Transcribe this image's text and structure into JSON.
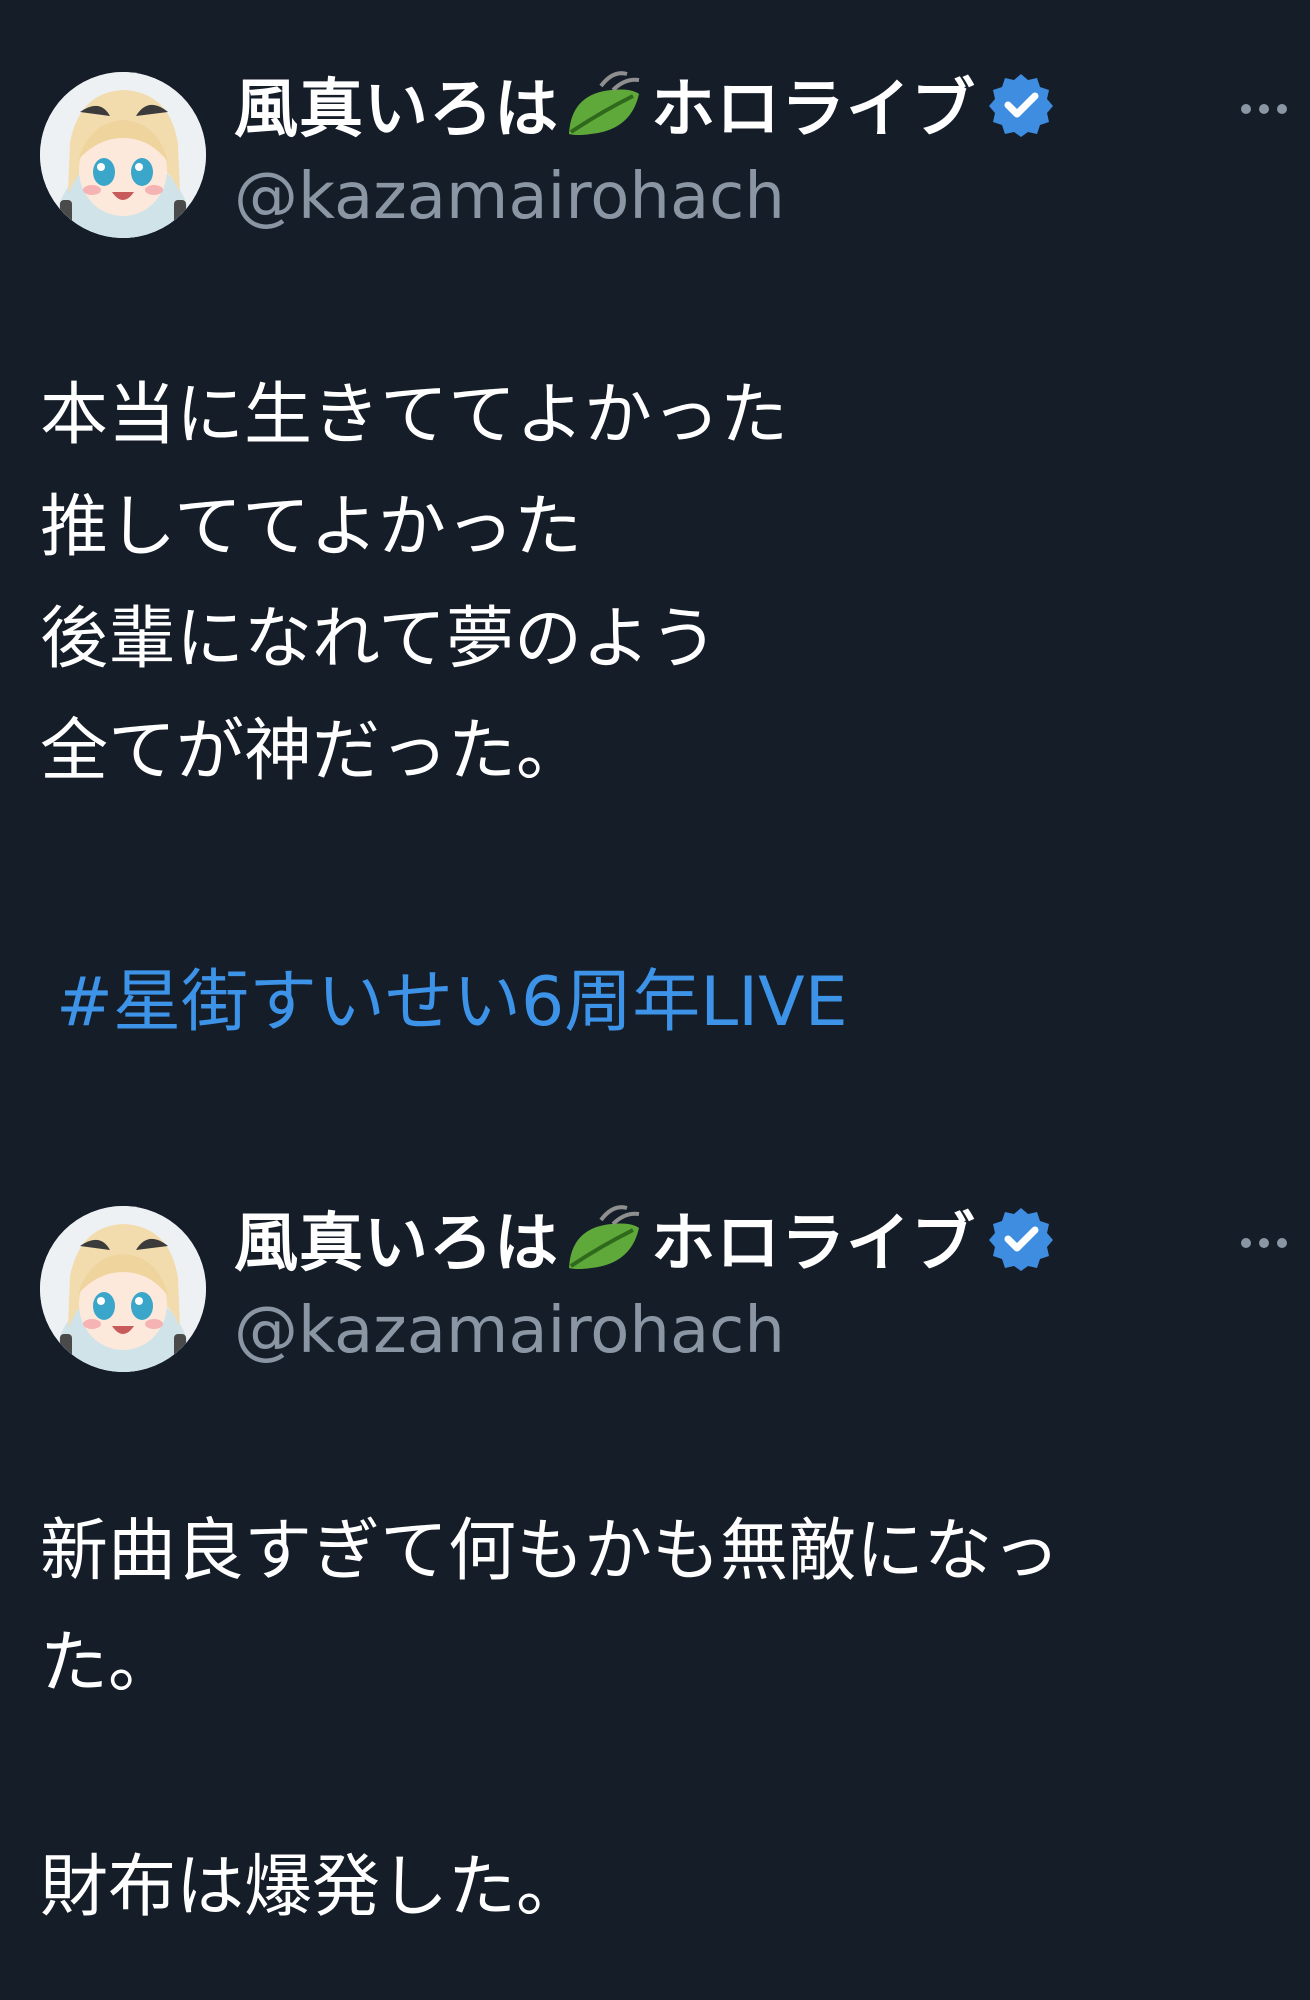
{
  "tweets": [
    {
      "author": {
        "display_name": "風真いろは",
        "name_suffix": "ホロライブ",
        "handle": "@kazamairohach",
        "name_emoji_icon": "leaf-icon",
        "verified_icon": "verified-badge-icon"
      },
      "more_icon": "more-options-icon",
      "lines": [
        "本当に生きててよかった",
        "推しててよかった",
        "後輩になれて夢のよう",
        "全てが神だった。"
      ],
      "hashtag": "#星街すいせい6周年LIVE"
    },
    {
      "author": {
        "display_name": "風真いろは",
        "name_suffix": "ホロライブ",
        "handle": "@kazamairohach",
        "name_emoji_icon": "leaf-icon",
        "verified_icon": "verified-badge-icon"
      },
      "more_icon": "more-options-icon",
      "lines": [
        "新曲良すぎて何もかも無敵になっ",
        "た。",
        "",
        "財布は爆発した。"
      ]
    }
  ],
  "colors": {
    "background": "#151d28",
    "text": "#ffffff",
    "handle": "#8a96a3",
    "hashtag": "#3c93e8",
    "verified": "#3f8de0"
  }
}
